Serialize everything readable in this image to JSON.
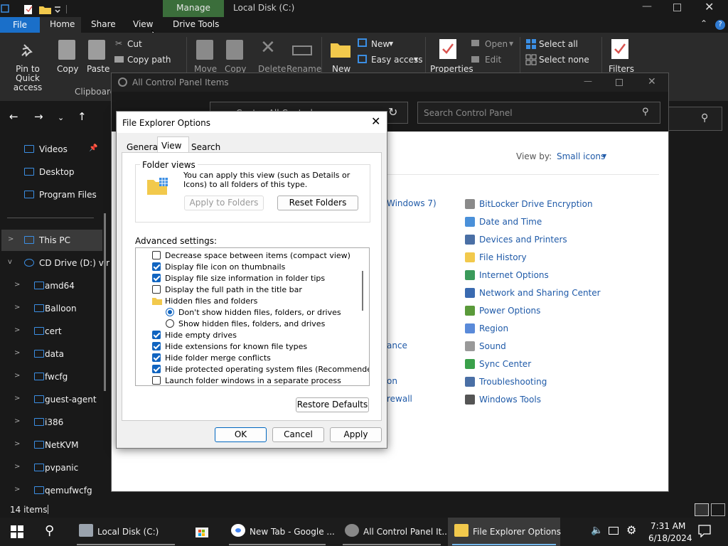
{
  "explorer": {
    "title": "Local Disk (C:)",
    "manage_tab": "Manage",
    "tabs": [
      "File",
      "Home",
      "Share",
      "View",
      "Drive Tools"
    ],
    "ribbon": {
      "pin_label": "Pin to Quick access",
      "copy": "Copy",
      "paste": "Paste",
      "cut": "Cut",
      "copy_path": "Copy path",
      "clipboard_group": "Clipboard",
      "move": "Move",
      "copy2": "Copy",
      "delete": "Delete",
      "rename": "Rename",
      "new": "New",
      "new_item": "New",
      "easy_access": "Easy access",
      "properties": "Properties",
      "open": "Open",
      "edit": "Edit",
      "select_all": "Select all",
      "select_none": "Select none",
      "filters": "Filters"
    },
    "nav_items": [
      {
        "label": "Videos",
        "type": "quick"
      },
      {
        "label": "Desktop",
        "type": "quick"
      },
      {
        "label": "Program Files",
        "type": "quick"
      },
      {
        "label": "This PC",
        "type": "pc"
      },
      {
        "label": "CD Drive (D:) vir",
        "type": "drive"
      },
      {
        "label": "amd64",
        "type": "folder"
      },
      {
        "label": "Balloon",
        "type": "folder"
      },
      {
        "label": "cert",
        "type": "folder"
      },
      {
        "label": "data",
        "type": "folder"
      },
      {
        "label": "fwcfg",
        "type": "folder"
      },
      {
        "label": "guest-agent",
        "type": "folder"
      },
      {
        "label": "i386",
        "type": "folder"
      },
      {
        "label": "NetKVM",
        "type": "folder"
      },
      {
        "label": "pvpanic",
        "type": "folder"
      },
      {
        "label": "qemufwcfg",
        "type": "folder"
      }
    ],
    "status": "14 items"
  },
  "control_panel": {
    "title": "All Control Panel Items",
    "breadcrumb": "Cont  >  All Control",
    "search_placeholder": "Search Control Panel",
    "view_by_label": "View by:",
    "view_by_value": "Small icons",
    "partial_left": [
      "Windows 7)",
      "ance",
      "on",
      "rewall"
    ],
    "items": [
      "BitLocker Drive Encryption",
      "Date and Time",
      "Devices and Printers",
      "File History",
      "Internet Options",
      "Network and Sharing Center",
      "Power Options",
      "Region",
      "Sound",
      "Sync Center",
      "Troubleshooting",
      "Windows Tools"
    ]
  },
  "dialog": {
    "title": "File Explorer Options",
    "tabs": [
      "General",
      "View",
      "Search"
    ],
    "active_tab": "View",
    "folder_views_group": "Folder views",
    "folder_views_desc": "You can apply this view (such as Details or Icons) to all folders of this type.",
    "apply_to_folders": "Apply to Folders",
    "reset_folders": "Reset Folders",
    "advanced_label": "Advanced settings:",
    "settings": [
      {
        "text": "Decrease space between items (compact view)",
        "kind": "checkbox",
        "checked": false,
        "indent": 0
      },
      {
        "text": "Display file icon on thumbnails",
        "kind": "checkbox",
        "checked": true,
        "indent": 0
      },
      {
        "text": "Display file size information in folder tips",
        "kind": "checkbox",
        "checked": true,
        "indent": 0
      },
      {
        "text": "Display the full path in the title bar",
        "kind": "checkbox",
        "checked": false,
        "indent": 0
      },
      {
        "text": "Hidden files and folders",
        "kind": "folder",
        "checked": false,
        "indent": 0
      },
      {
        "text": "Don't show hidden files, folders, or drives",
        "kind": "radio",
        "checked": true,
        "indent": 1
      },
      {
        "text": "Show hidden files, folders, and drives",
        "kind": "radio",
        "checked": false,
        "indent": 1
      },
      {
        "text": "Hide empty drives",
        "kind": "checkbox",
        "checked": true,
        "indent": 0
      },
      {
        "text": "Hide extensions for known file types",
        "kind": "checkbox",
        "checked": true,
        "indent": 0
      },
      {
        "text": "Hide folder merge conflicts",
        "kind": "checkbox",
        "checked": true,
        "indent": 0
      },
      {
        "text": "Hide protected operating system files (Recommended)",
        "kind": "checkbox",
        "checked": true,
        "indent": 0
      },
      {
        "text": "Launch folder windows in a separate process",
        "kind": "checkbox",
        "checked": false,
        "indent": 0
      }
    ],
    "restore_defaults": "Restore Defaults",
    "ok": "OK",
    "cancel": "Cancel",
    "apply": "Apply"
  },
  "taskbar": {
    "items": [
      "Local Disk (C:)",
      "New Tab - Google ...",
      "All Control Panel It...",
      "File Explorer Options"
    ],
    "active_index": 3,
    "time": "7:31 AM",
    "date": "6/18/2024"
  },
  "colors": {
    "accent": "#1064c0",
    "link": "#1f5aa8",
    "manage_tab": "#3b6e3b",
    "file_tab": "#1a6fc9"
  }
}
